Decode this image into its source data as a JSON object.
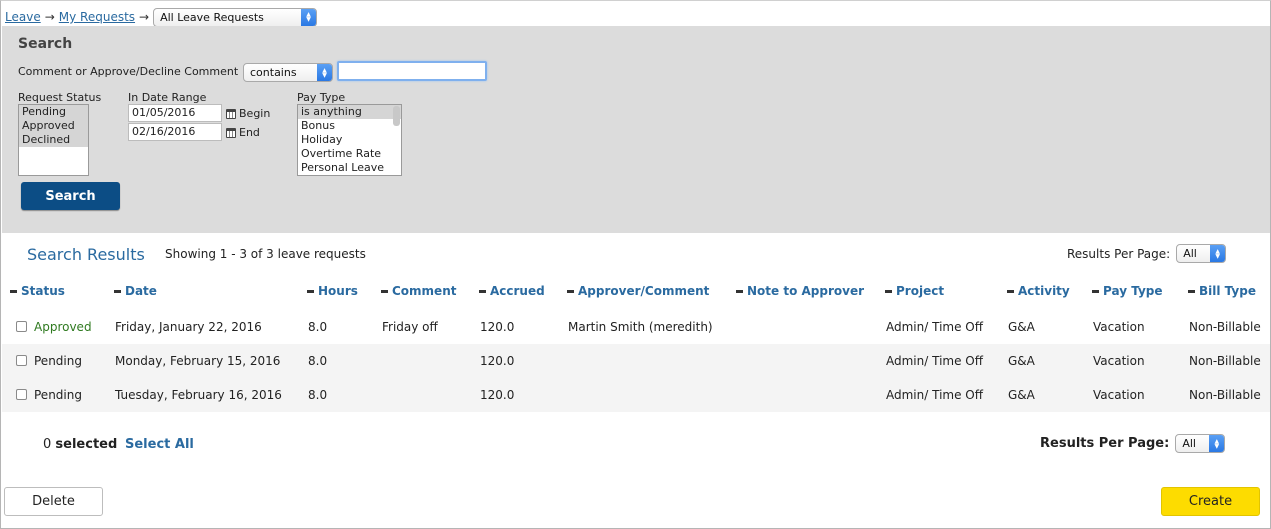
{
  "breadcrumb": {
    "items": [
      "Leave",
      "My Requests"
    ],
    "separator": "→",
    "view_select": "All Leave Requests"
  },
  "search": {
    "title": "Search",
    "comment_label": "Comment or Approve/Decline Comment",
    "comment_operator": "contains",
    "comment_value": "",
    "status_label": "Request Status",
    "status_options": [
      "Pending",
      "Approved",
      "Declined"
    ],
    "date_range_label": "In Date Range",
    "begin_date": "01/05/2016",
    "begin_label": "Begin",
    "end_date": "02/16/2016",
    "end_label": "End",
    "pay_type_label": "Pay Type",
    "pay_type_options": [
      "is anything",
      "Bonus",
      "Holiday",
      "Overtime Rate",
      "Personal Leave"
    ],
    "button": "Search"
  },
  "results": {
    "title": "Search Results",
    "showing": "Showing 1 - 3 of 3 leave requests",
    "per_page_label_top": "Results Per Page:",
    "per_page_label_bottom": "Results Per Page:",
    "per_page_value": "All",
    "columns": [
      "Status",
      "Date",
      "Hours",
      "Comment",
      "Accrued",
      "Approver/Comment",
      "Note to Approver",
      "Project",
      "Activity",
      "Pay Type",
      "Bill Type"
    ],
    "rows": [
      {
        "status": "Approved",
        "date": "Friday, January 22, 2016",
        "hours": "8.0",
        "comment": "Friday off",
        "accrued": "120.0",
        "approver": "Martin Smith (meredith)",
        "note": "",
        "project": "Admin/ Time Off",
        "activity": "G&A",
        "pay_type": "Vacation",
        "bill_type": "Non-Billable"
      },
      {
        "status": "Pending",
        "date": "Monday, February 15, 2016",
        "hours": "8.0",
        "comment": "",
        "accrued": "120.0",
        "approver": "",
        "note": "",
        "project": "Admin/ Time Off",
        "activity": "G&A",
        "pay_type": "Vacation",
        "bill_type": "Non-Billable"
      },
      {
        "status": "Pending",
        "date": "Tuesday, February 16, 2016",
        "hours": "8.0",
        "comment": "",
        "accrued": "120.0",
        "approver": "",
        "note": "",
        "project": "Admin/ Time Off",
        "activity": "G&A",
        "pay_type": "Vacation",
        "bill_type": "Non-Billable"
      }
    ],
    "selected_count": "0",
    "selected_label": "selected",
    "select_all": "Select All"
  },
  "actions": {
    "delete": "Delete",
    "create": "Create"
  },
  "colors": {
    "link": "#2a6aa0",
    "search_button": "#0c4d85",
    "create_button": "#fddc00",
    "approved": "#2f7a20",
    "panel": "#dcdcdc"
  }
}
